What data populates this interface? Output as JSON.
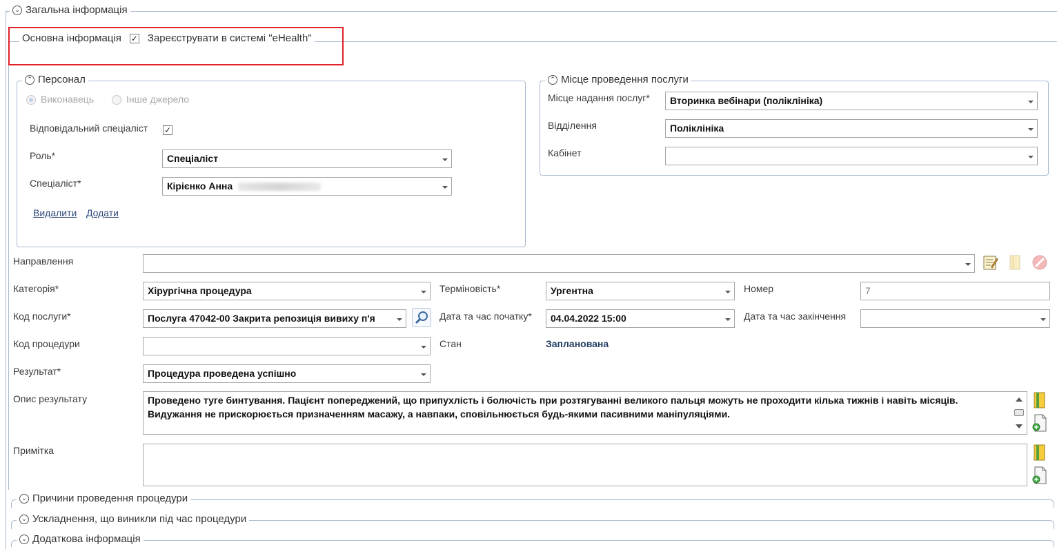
{
  "sections": {
    "general_info": "Загальна інформація",
    "reasons": "Причини проведення процедури",
    "complications": "Ускладнення, що виникли під час процедури",
    "additional_info": "Додаткова інформація"
  },
  "main_info": {
    "title": "Основна інформація",
    "ehealth_label": "Зареєструвати в системі \"eHealth\"",
    "ehealth_checked": true
  },
  "personnel": {
    "title": "Персонал",
    "radio_executor": "Виконавець",
    "radio_other": "Інше джерело",
    "responsible_label": "Відповідальний спеціаліст",
    "role_label": "Роль*",
    "role_value": "Спеціаліст",
    "specialist_label": "Спеціаліст*",
    "specialist_value": "Кірієнко Анна",
    "delete_link": "Видалити",
    "add_link": "Додати"
  },
  "location": {
    "title": "Місце проведення послуги",
    "place_label": "Місце надання послуг*",
    "place_value": "Вторинка вебінари (поліклініка)",
    "department_label": "Відділення",
    "department_value": "Поліклініка",
    "cabinet_label": "Кабінет",
    "cabinet_value": ""
  },
  "form": {
    "referral_label": "Направлення",
    "referral_value": "",
    "category_label": "Категорія*",
    "category_value": "Хірургічна процедура",
    "urgency_label": "Терміновість*",
    "urgency_value": "Ургентна",
    "number_label": "Номер",
    "number_value": "7",
    "service_code_label": "Код послуги*",
    "service_code_value": "Послуга 47042-00 Закрита репозиція вивиху п'я",
    "start_label": "Дата та час початку*",
    "start_value": "04.04.2022 15:00",
    "end_label": "Дата та час закінчення",
    "end_value": "",
    "procedure_code_label": "Код процедури",
    "procedure_code_value": "",
    "status_label": "Стан",
    "status_value": "Запланована",
    "result_label": "Результат*",
    "result_value": "Процедура проведена успішно",
    "result_desc_label": "Опис результату",
    "result_desc_value": "Проведено туге бинтування. Пацієнт попереджений, що припухлість і болючість при розтягуванні великого пальця можуть не проходити кілька тижнів і навіть місяців. Видужання не прискорюється призначенням масажу, а навпаки, сповільнюється будь-якими пасивними маніпуляціями.",
    "note_label": "Примітка",
    "note_value": ""
  },
  "colors": {
    "highlight_box": "#e0212a",
    "group_border": "#a9b8cf",
    "status_text": "#1f3a5f"
  },
  "icons": [
    "chevron-down-icon",
    "chevron-up-icon",
    "edit-note-icon",
    "book-icon",
    "cancel-icon",
    "search-icon",
    "add-document-icon"
  ]
}
